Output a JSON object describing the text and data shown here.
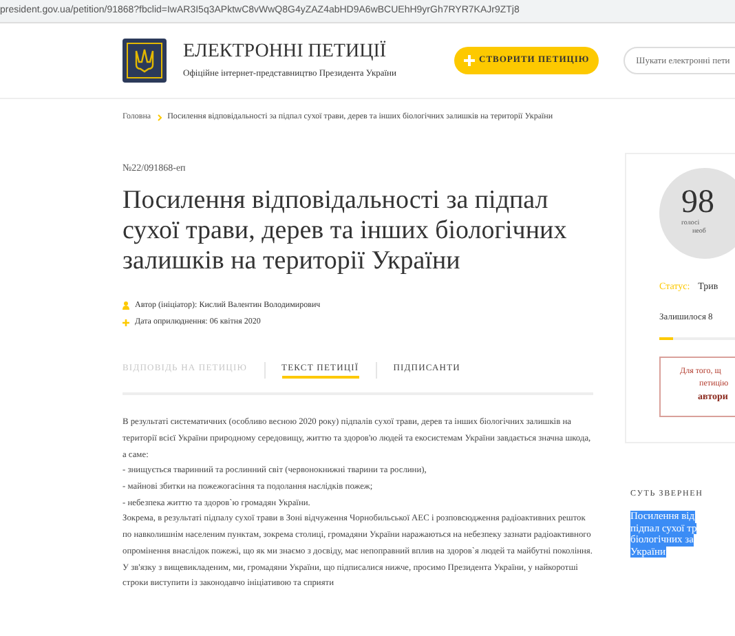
{
  "address_bar": {
    "url": "president.gov.ua/petition/91868?fbclid=IwAR3I5q3APktwC8vWwQ8G4yZAZ4abHD9A6wBCUEhH9yrGh7RYR7KAJr9ZTj8"
  },
  "header": {
    "title": "ЕЛЕКТРОННІ ПЕТИЦІЇ",
    "subtitle": "Офіційне інтернет-представництво Президента України",
    "create_button": "СТВОРИТИ ПЕТИЦІЮ",
    "search": {
      "placeholder": "Шукати електронні пети"
    }
  },
  "breadcrumb": [
    "Головна",
    "Посилення відповідальності за підпал сухої трави, дерев та інших біологічних залишків на території України"
  ],
  "petition": {
    "number": "№22/091868-еп",
    "title": "Посилення відповідальності за підпал сухої трави, дерев та інших біологічних залишків на території України",
    "author": "Автор (ініціатор): Кислий Валентин Володимирович",
    "date": "Дата оприлюднення: 06 квітня 2020"
  },
  "tabs": [
    {
      "label": "ВІДПОВІДЬ НА ПЕТИЦІЮ",
      "selected": false,
      "disabled": true
    },
    {
      "label": "ТЕКСТ ПЕТИЦІЇ",
      "selected": true,
      "disabled": false
    },
    {
      "label": "ПІДПИСАНТИ",
      "selected": false,
      "disabled": false
    }
  ],
  "body": [
    "В результаті систематичних (особливо весною 2020 року) підпалів сухої трави, дерев та інших біологічних залишків на території всієї України природному середовищу, життю та здоров'ю людей та екосистемам України завдається значна шкода, а саме:",
    "- знищується тваринний та рослинний світ (червонокнижні тварини та рослини),",
    "- майнові збитки на пожежогасіння та подолання наслідків пожеж;",
    "- небезпека життю та здоров`ю громадян України.",
    "Зокрема, в результаті підпалу сухої трави в Зоні відчуження Чорнобильської АЕС і розповсюдження радіоактивних решток по навколишнім населеним пунктам, зокрема столиці, громадяни України наражаються на небезпеку зазнати радіоактивного опромінення внаслідок пожежі, що як ми знаємо з досвіду, має непоправний вплив на здоров`я людей та майбутні покоління.",
    "У зв'язку з вищевикладеним, ми, громадяни України, що підписалися нижче, просимо Президента України, у найкоротші строки виступити із законодавчо ініціативою та сприяти"
  ],
  "sidebar": {
    "votes": "98",
    "votes_caption": [
      "голосі",
      "необ"
    ],
    "status_label": "Статус:",
    "status_value": "Трив",
    "remaining": "Залишилося 8",
    "progress": {
      "level": 0.08
    },
    "notice": [
      "Для того, щ",
      "петицію"
    ],
    "notice_link": "автори",
    "essence_heading": "СУТЬ ЗВЕРНЕН",
    "essence_lines": [
      "Посилення від",
      "підпал сухої тр",
      "біологічних за",
      "України"
    ]
  }
}
